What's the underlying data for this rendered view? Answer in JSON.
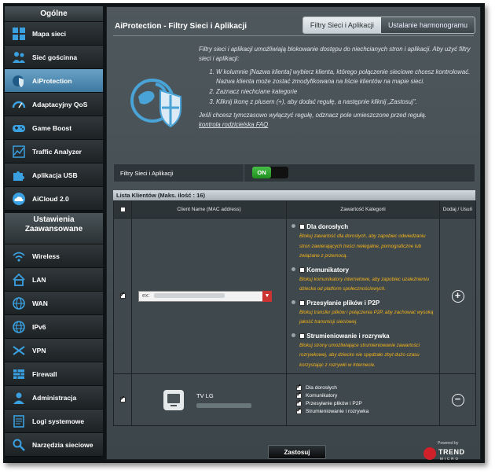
{
  "sidebar": {
    "general_header": "Ogólne",
    "general_items": [
      {
        "label": "Mapa sieci",
        "icon": "network-map-icon",
        "active": false
      },
      {
        "label": "Sieć gościnna",
        "icon": "guest-network-icon",
        "active": false
      },
      {
        "label": "AiProtection",
        "icon": "aiprotection-icon",
        "active": true
      },
      {
        "label": "Adaptacyjny QoS",
        "icon": "qos-gauge-icon",
        "active": false
      },
      {
        "label": "Game Boost",
        "icon": "gamepad-icon",
        "active": false
      },
      {
        "label": "Traffic Analyzer",
        "icon": "traffic-analyzer-icon",
        "active": false
      },
      {
        "label": "Aplikacja USB",
        "icon": "usb-puzzle-icon",
        "active": false
      },
      {
        "label": "AiCloud 2.0",
        "icon": "cloud-icon",
        "active": false
      }
    ],
    "advanced_header": "Ustawienia Zaawansowane",
    "advanced_items": [
      {
        "label": "Wireless",
        "icon": "wireless-icon"
      },
      {
        "label": "LAN",
        "icon": "lan-home-icon"
      },
      {
        "label": "WAN",
        "icon": "wan-globe-icon"
      },
      {
        "label": "IPv6",
        "icon": "ipv6-globe-icon"
      },
      {
        "label": "VPN",
        "icon": "vpn-icon"
      },
      {
        "label": "Firewall",
        "icon": "firewall-icon"
      },
      {
        "label": "Administracja",
        "icon": "admin-user-icon"
      },
      {
        "label": "Logi systemowe",
        "icon": "system-log-icon"
      },
      {
        "label": "Narzędzia sieciowe",
        "icon": "network-tools-icon"
      }
    ]
  },
  "header": {
    "title": "AiProtection - Filtry Sieci i Aplikacji",
    "tabs": [
      {
        "label": "Filtry Sieci i Aplikacji",
        "active": true
      },
      {
        "label": "Ustalanie harmonogramu",
        "active": false
      }
    ]
  },
  "intro": {
    "lead": "Filtry sieci i aplikacji umożliwiają blokowanie dostępu do niechcianych stron i aplikacji. Aby użyć filtry sieci i aplikacji:",
    "steps": [
      "W kolumnie [Nazwa klienta] wybierz klienta, którego połączenie sieciowe chcesz kontrolować. Nazwa klienta może zostać zmodyfikowana na liście klientów na mapie sieci.",
      "Zaznacz niechciane kategorie",
      "Kliknij ikonę z plusem (+), aby dodać regułę, a następnie kliknij „Zastosuj\"."
    ],
    "note": "Jeśli chcesz tymczasowo wyłączyć regułę, odznacz pole umieszczone przed regułą.",
    "faq_link": "kontrola rodzicielska FAQ"
  },
  "toggle": {
    "label": "Filtry Sieci i Aplikacji",
    "state": "ON"
  },
  "client_list": {
    "header": "Lista Klientów (Maks. ilość : 16)",
    "columns": [
      "",
      "Client Name (MAC address)",
      "Zawartość Kategorii",
      "Dodaj / Usuń"
    ],
    "new_rule": {
      "select_prefix": "ex:",
      "categories": [
        {
          "title": "Dla dorosłych",
          "desc": "Blokuj zawartość dla dorosłych, aby zapobiec odwiedzaniu stron zawierających treści nielegalne, pornograficzne lub związane z przemocą."
        },
        {
          "title": "Komunikatory",
          "desc": "Blokuj komunikatory internetowe, aby zapobiec uzależnieniu dziecka od platform społecznościowych."
        },
        {
          "title": "Przesyłanie plików i P2P",
          "desc": "Blokuj transfer plików i połączenia P2P, aby zachować wysoką jakość transmisji sieciowej."
        },
        {
          "title": "Strumieniowanie i rozrywka",
          "desc": "Blokuj strony umożliwiające strumieniowanie zawartości rozrywkowej, aby dziecko nie spędzało zbyt dużo czasu korzystając z rozrywki w Internecie."
        }
      ]
    },
    "existing_rule": {
      "device_name": "TV LG",
      "categories": [
        "Dla dorosłych",
        "Komunikatory",
        "Przesyłanie plików i P2P",
        "Strumieniowanie i rozrywka"
      ]
    }
  },
  "actions": {
    "apply_label": "Zastosuj"
  },
  "footer": {
    "powered_by": "Powered by",
    "brand": "TREND",
    "brand_sub": "MICRO"
  },
  "colors": {
    "active_nav": "#4f8db6",
    "warning_text": "#f5b51b",
    "toggle_on": "#2fa82f"
  }
}
